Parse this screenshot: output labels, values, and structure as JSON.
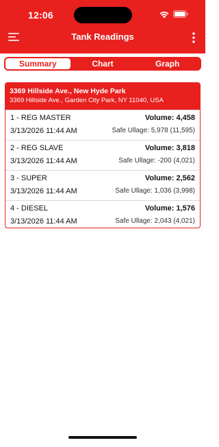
{
  "status": {
    "time": "12:06"
  },
  "nav": {
    "title": "Tank Readings"
  },
  "tabs": [
    {
      "label": "Summary",
      "active": true
    },
    {
      "label": "Chart",
      "active": false
    },
    {
      "label": "Graph",
      "active": false
    }
  ],
  "location": {
    "name": "3369 Hillside Ave., New Hyde Park",
    "address": "3369 Hillside Ave., Garden City Park, NY 11040, USA"
  },
  "tanks": [
    {
      "name": "1 - REG MASTER",
      "volume": "Volume: 4,458",
      "date": "3/13/2026 11:44 AM",
      "ullage": "Safe Ullage: 5,978 (11,595)"
    },
    {
      "name": "2 - REG SLAVE",
      "volume": "Volume: 3,818",
      "date": "3/13/2026 11:44 AM",
      "ullage": "Safe Ullage: -200 (4,021)"
    },
    {
      "name": "3 - SUPER",
      "volume": "Volume: 2,562",
      "date": "3/13/2026 11:44 AM",
      "ullage": "Safe Ullage: 1,036 (3,998)"
    },
    {
      "name": "4 - DIESEL",
      "volume": "Volume: 1,576",
      "date": "3/13/2026 11:44 AM",
      "ullage": "Safe Ullage: 2,043 (4,021)"
    }
  ],
  "colors": {
    "accent": "#e8201e"
  },
  "icons": {
    "menu": "menu-icon",
    "more": "more-vertical-icon",
    "wifi": "wifi-icon",
    "battery": "battery-icon"
  }
}
